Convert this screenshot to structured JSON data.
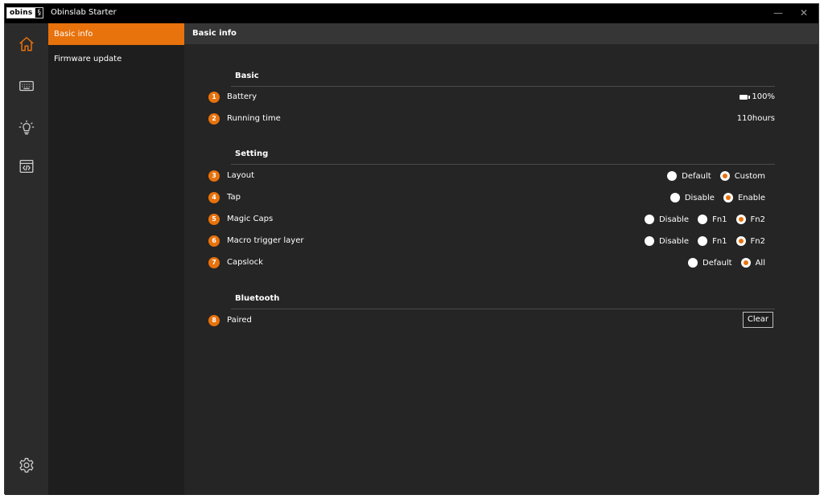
{
  "titlebar": {
    "logo_text": "obins",
    "logo_mark": "§",
    "app_title": "Obinslab Starter",
    "minimize": "—",
    "close": "✕"
  },
  "iconbar": {
    "items": [
      "home-icon",
      "keyboard-icon",
      "lighting-icon",
      "macro-code-icon"
    ],
    "bottom": "settings-gear-icon"
  },
  "subnav": {
    "items": [
      {
        "label": "Basic info",
        "active": true
      },
      {
        "label": "Firmware update",
        "active": false
      }
    ]
  },
  "main": {
    "header": "Basic info",
    "sections": {
      "basic": {
        "title": "Basic",
        "battery": {
          "num": "1",
          "label": "Battery",
          "value": "100%"
        },
        "running": {
          "num": "2",
          "label": "Running time",
          "value": "110hours"
        }
      },
      "setting": {
        "title": "Setting",
        "layout": {
          "num": "3",
          "label": "Layout",
          "options": [
            "Default",
            "Custom"
          ],
          "selected": "Custom"
        },
        "tap": {
          "num": "4",
          "label": "Tap",
          "options": [
            "Disable",
            "Enable"
          ],
          "selected": "Enable"
        },
        "magic_caps": {
          "num": "5",
          "label": "Magic Caps",
          "options": [
            "Disable",
            "Fn1",
            "Fn2"
          ],
          "selected": "Fn2"
        },
        "macro_layer": {
          "num": "6",
          "label": "Macro trigger layer",
          "options": [
            "Disable",
            "Fn1",
            "Fn2"
          ],
          "selected": "Fn2"
        },
        "capslock": {
          "num": "7",
          "label": "Capslock",
          "options": [
            "Default",
            "All"
          ],
          "selected": "All"
        }
      },
      "bluetooth": {
        "title": "Bluetooth",
        "paired": {
          "num": "8",
          "label": "Paired",
          "button": "Clear"
        }
      }
    }
  },
  "colors": {
    "accent": "#e8720c",
    "background": "#252525",
    "sidebar": "#2b2b2b",
    "titlebar": "#000000"
  }
}
